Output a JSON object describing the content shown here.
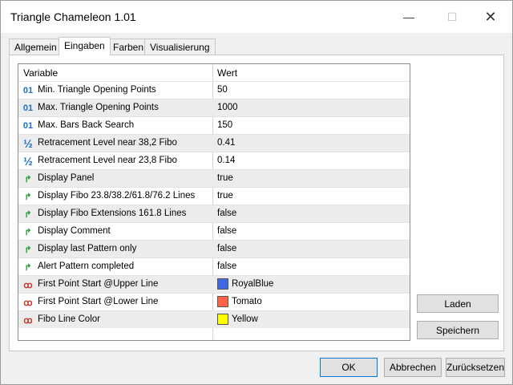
{
  "window": {
    "title": "Triangle Chameleon 1.01",
    "minimize_glyph": "—",
    "maximize_glyph": "☐",
    "close_glyph": "✕"
  },
  "tabs": [
    {
      "label": "Allgemein",
      "active": false
    },
    {
      "label": "Eingaben",
      "active": true
    },
    {
      "label": "Farben",
      "active": false
    },
    {
      "label": "Visualisierung",
      "active": false
    }
  ],
  "grid": {
    "header_variable": "Variable",
    "header_value": "Wert",
    "rows": [
      {
        "icon": "integer-icon",
        "glyph": "01",
        "name": "Min. Triangle Opening Points",
        "value": "50"
      },
      {
        "icon": "integer-icon",
        "glyph": "01",
        "name": "Max. Triangle Opening Points",
        "value": "1000"
      },
      {
        "icon": "integer-icon",
        "glyph": "01",
        "name": "Max. Bars Back Search",
        "value": "150"
      },
      {
        "icon": "fraction-icon",
        "glyph": "½",
        "name": "Retracement Level near 38,2 Fibo",
        "value": "0.41"
      },
      {
        "icon": "fraction-icon",
        "glyph": "½",
        "name": "Retracement Level near 23,8 Fibo",
        "value": "0.14"
      },
      {
        "icon": "boolean-icon",
        "glyph": "↱",
        "name": "Display Panel",
        "value": "true"
      },
      {
        "icon": "boolean-icon",
        "glyph": "↱",
        "name": "Display Fibo 23.8/38.2/61.8/76.2 Lines",
        "value": "true"
      },
      {
        "icon": "boolean-icon",
        "glyph": "↱",
        "name": "Display Fibo Extensions 161.8 Lines",
        "value": "false"
      },
      {
        "icon": "boolean-icon",
        "glyph": "↱",
        "name": "Display Comment",
        "value": "false"
      },
      {
        "icon": "boolean-icon",
        "glyph": "↱",
        "name": "Display last Pattern only",
        "value": "false"
      },
      {
        "icon": "boolean-icon",
        "glyph": "↱",
        "name": "Alert Pattern completed",
        "value": "false"
      },
      {
        "icon": "color-icon",
        "glyph": "ꝏ",
        "name": "First Point Start @Upper Line",
        "value": "RoyalBlue",
        "swatch": "#4169e1"
      },
      {
        "icon": "color-icon",
        "glyph": "ꝏ",
        "name": "First Point Start @Lower Line",
        "value": "Tomato",
        "swatch": "#ff6347"
      },
      {
        "icon": "color-icon",
        "glyph": "ꝏ",
        "name": "Fibo Line Color",
        "value": "Yellow",
        "swatch": "#ffff00"
      }
    ]
  },
  "side_buttons": {
    "load": "Laden",
    "save": "Speichern"
  },
  "footer_buttons": {
    "ok": "OK",
    "cancel": "Abbrechen",
    "reset": "Zurücksetzen"
  },
  "colors": {
    "accent": "#0078d7",
    "boolean_icon": "#2e9e3c",
    "integer_icon": "#1c6fc4"
  }
}
